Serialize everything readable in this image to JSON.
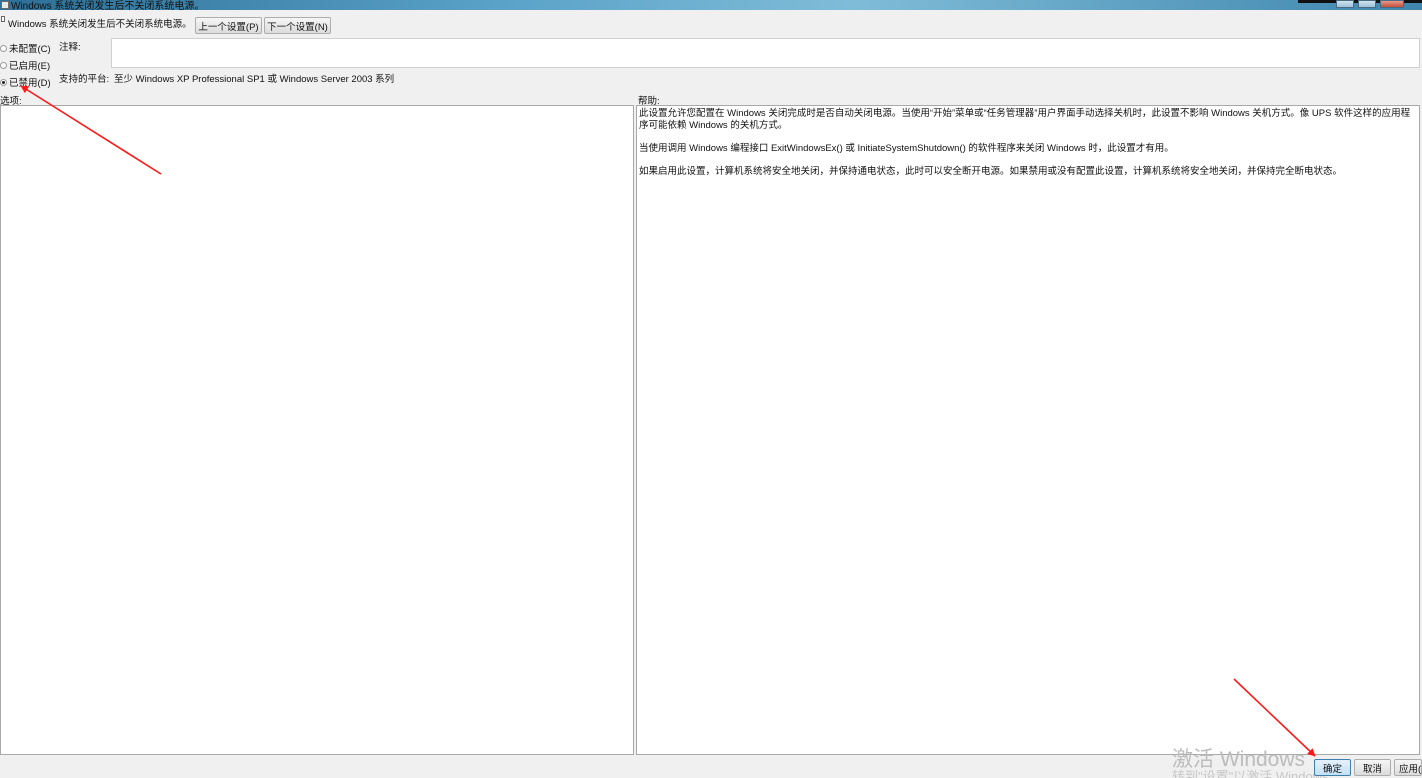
{
  "window": {
    "title": "Windows 系统关闭发生后不关闭系统电源。"
  },
  "header": {
    "policy_name": "Windows 系统关闭发生后不关闭系统电源。",
    "prev_button": "上一个设置(P)",
    "next_button": "下一个设置(N)"
  },
  "state": {
    "options": [
      {
        "label": "未配置(C)",
        "checked": false
      },
      {
        "label": "已启用(E)",
        "checked": false
      },
      {
        "label": "已禁用(D)",
        "checked": true
      }
    ]
  },
  "comment": {
    "label": "注释:",
    "value": ""
  },
  "platform": {
    "label": "支持的平台:",
    "value": "至少 Windows XP Professional SP1 或 Windows Server 2003 系列"
  },
  "options_pane": {
    "label": "选项:"
  },
  "help_pane": {
    "label": "帮助:",
    "paragraphs": [
      "此设置允许您配置在 Windows 关闭完成时是否自动关闭电源。当使用“开始”菜单或“任务管理器”用户界面手动选择关机时，此设置不影响 Windows 关机方式。像 UPS 软件这样的应用程序可能依赖 Windows 的关机方式。",
      "当使用调用 Windows 编程接口 ExitWindowsEx() 或 InitiateSystemShutdown() 的软件程序来关闭 Windows 时，此设置才有用。",
      "如果启用此设置，计算机系统将安全地关闭，并保持通电状态，此时可以安全断开电源。如果禁用或没有配置此设置，计算机系统将安全地关闭，并保持完全断电状态。"
    ]
  },
  "footer": {
    "ok_button": "确定",
    "cancel_button": "取消",
    "apply_button": "应用(A)",
    "watermark_line1": "激活 Windows",
    "watermark_line2": "转到\"设置\"以激活 Windows。"
  },
  "colors": {
    "annotation_arrow": "#ff1a1a",
    "titlebar": "#5aa2c8",
    "ok_button_border": "#3c7fb1"
  }
}
